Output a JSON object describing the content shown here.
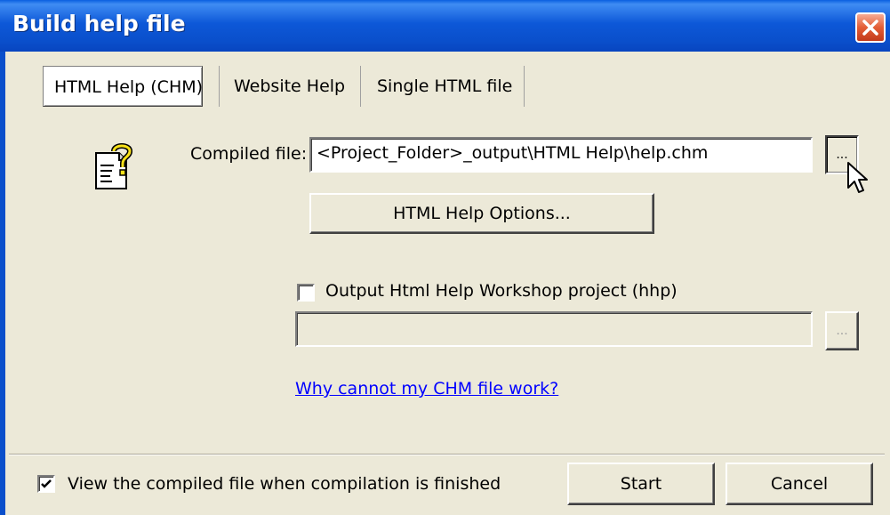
{
  "window": {
    "title": "Build help file"
  },
  "tabs": [
    {
      "label": "HTML Help (CHM)",
      "active": true
    },
    {
      "label": "Website Help",
      "active": false
    },
    {
      "label": "Single HTML file",
      "active": false
    }
  ],
  "compiled": {
    "label": "Compiled file:",
    "value": "<Project_Folder>_output\\HTML Help\\help.chm",
    "browse_label": "..."
  },
  "options_button": "HTML Help Options...",
  "hhp": {
    "checkbox_label": "Output Html Help Workshop project (hhp)",
    "checked": false,
    "value": "",
    "browse_label": "..."
  },
  "help_link": "Why cannot my CHM file work?",
  "view_compiled": {
    "label": "View the compiled file when compilation is finished",
    "checked": true
  },
  "buttons": {
    "start": "Start",
    "cancel": "Cancel"
  },
  "icons": {
    "title_close": "close-icon",
    "help": "help-document-icon",
    "cursor": "mouse-cursor-icon"
  },
  "colors": {
    "titlebar": "#0a4fcb",
    "close": "#e35d35",
    "face": "#ece9d8",
    "link": "#0000ff"
  }
}
